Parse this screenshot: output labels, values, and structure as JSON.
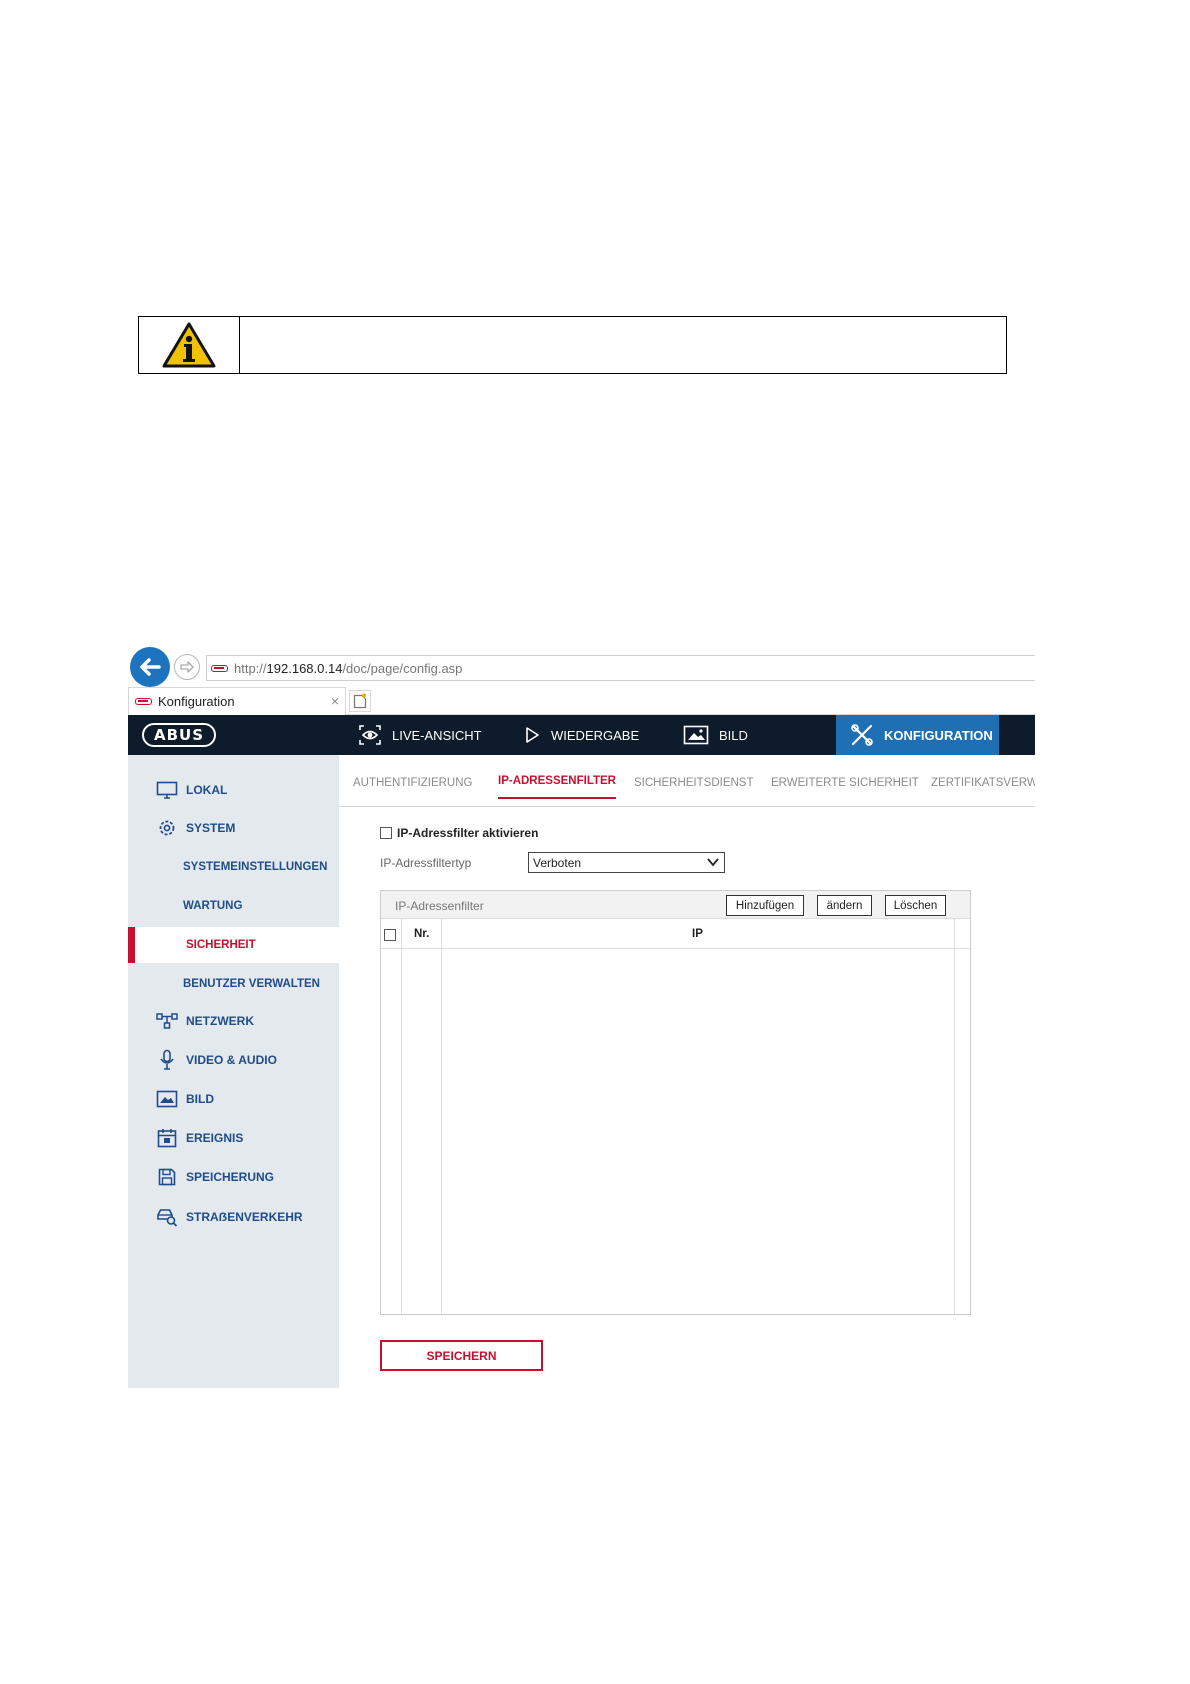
{
  "browser": {
    "url_prefix": "http://",
    "url_host": "192.168.0.14",
    "url_path": "/doc/page/config.asp",
    "tab_title": "Konfiguration",
    "tab_close": "×"
  },
  "header": {
    "logo": "ABUS",
    "nav": {
      "live": "LIVE-ANSICHT",
      "playback": "WIEDERGABE",
      "image": "BILD",
      "config": "KONFIGURATION"
    }
  },
  "sidebar": {
    "items": [
      {
        "label": "LOKAL"
      },
      {
        "label": "SYSTEM"
      },
      {
        "label": "SYSTEMEINSTELLUNGEN"
      },
      {
        "label": "WARTUNG"
      },
      {
        "label": "SICHERHEIT"
      },
      {
        "label": "BENUTZER VERWALTEN"
      },
      {
        "label": "NETZWERK"
      },
      {
        "label": "VIDEO & AUDIO"
      },
      {
        "label": "BILD"
      },
      {
        "label": "EREIGNIS"
      },
      {
        "label": "SPEICHERUNG"
      },
      {
        "label": "STRAẞENVERKEHR"
      }
    ]
  },
  "subtabs": {
    "auth": "AUTHENTIFIZIERUNG",
    "ipfilter": "IP-ADRESSENFILTER",
    "service": "SICHERHEITSDIENST",
    "advanced": "ERWEITERTE SICHERHEIT",
    "cert": "ZERTIFIKATSVERW"
  },
  "form": {
    "enable_label": "IP-Adressfilter aktivieren",
    "type_label": "IP-Adressfiltertyp",
    "type_value": "Verboten"
  },
  "panel": {
    "title": "IP-Adressenfilter",
    "add": "Hinzufügen",
    "edit": "ändern",
    "delete": "Löschen",
    "col_nr": "Nr.",
    "col_ip": "IP"
  },
  "save_label": "SPEICHERN"
}
